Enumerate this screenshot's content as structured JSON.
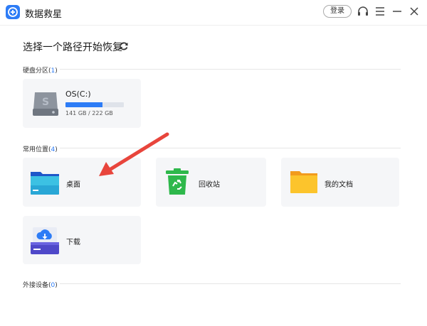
{
  "app": {
    "title": "数据救星"
  },
  "titlebar": {
    "login_label": "登录"
  },
  "main": {
    "heading": "选择一个路径开始恢复"
  },
  "sections": {
    "disks": {
      "label": "硬盘分区(",
      "count": "1",
      "close": ")"
    },
    "common": {
      "label": "常用位置(",
      "count": "4",
      "close": ")"
    },
    "external": {
      "label": "外接设备(",
      "count": "0",
      "close": ")"
    }
  },
  "drive": {
    "name": "OS(C:)",
    "size_text": "141 GB / 222 GB",
    "used_fraction": 0.635
  },
  "locations": [
    {
      "label": "桌面"
    },
    {
      "label": "回收站"
    },
    {
      "label": "我的文档"
    },
    {
      "label": "下载"
    }
  ],
  "colors": {
    "accent": "#2d7cf6",
    "arrow": "#e8453c",
    "recycle": "#2eb84b",
    "folder": "#f7b733"
  },
  "icons": {
    "logo": "plus-circle-icon",
    "headset": "headset-icon",
    "menu": "menu-icon",
    "minimize": "minimize-icon",
    "close": "close-icon",
    "refresh": "refresh-icon",
    "drive": "hard-drive-icon",
    "desktop": "desktop-folder-icon",
    "recycle": "recycle-bin-icon",
    "documents": "documents-folder-icon",
    "downloads": "downloads-icon"
  }
}
